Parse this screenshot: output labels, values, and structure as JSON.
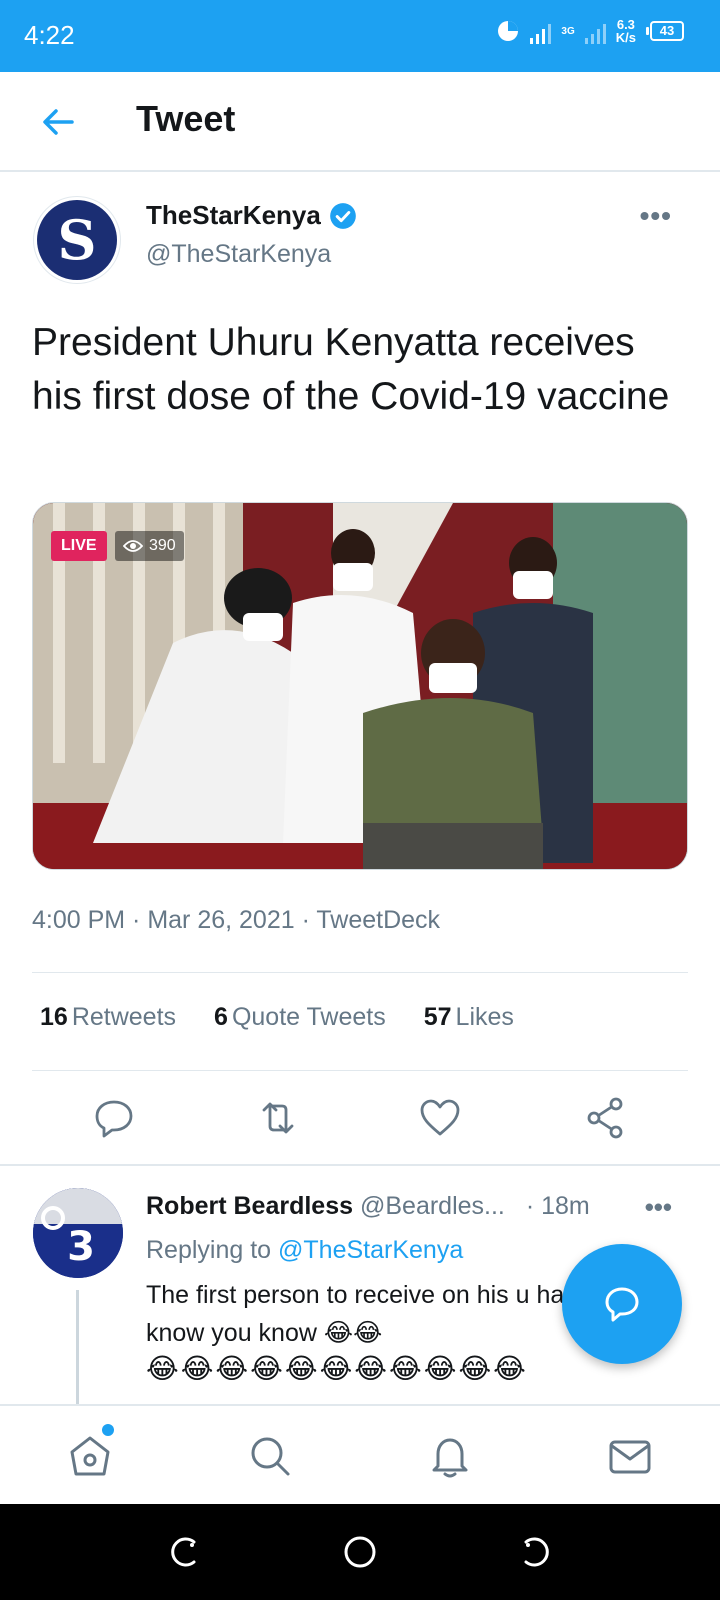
{
  "status_bar": {
    "time": "4:22",
    "speed_value": "6.3",
    "speed_unit": "K/s",
    "battery": "43",
    "network": "3G"
  },
  "header": {
    "title": "Tweet",
    "back_icon": "arrow-left-icon"
  },
  "tweet": {
    "author_name": "TheStarKenya",
    "author_handle": "@TheStarKenya",
    "avatar_letter": "S",
    "text": "President Uhuru Kenyatta receives  his first dose of the Covid-19 vaccine",
    "media": {
      "live_label": "LIVE",
      "view_count": "390"
    },
    "timestamp": "4:00 PM · Mar 26, 2021 · TweetDeck",
    "stats": {
      "retweets_count": "16",
      "retweets_label": "Retweets",
      "quotes_count": "6",
      "quotes_label": "Quote Tweets",
      "likes_count": "57",
      "likes_label": "Likes"
    },
    "more_label": "•••"
  },
  "reply": {
    "name": "Robert Beardless",
    "handle": "@Beardles...",
    "time": "· 18m",
    "replying_prefix": "Replying to",
    "replying_to": "@TheStarKenya",
    "text": "The first person to receive on his u hand, if you know you know 😂😂",
    "emoji_tail": "😂",
    "emoji_line": "😂😂😂😂😂😂😂😂😂😂😂",
    "more_label": "•••"
  },
  "colors": {
    "accent": "#1da1f2",
    "text_secondary": "#657786",
    "divider": "#e1e8ed"
  },
  "bottom_nav": [
    "home-icon",
    "search-icon",
    "notifications-icon",
    "messages-icon"
  ],
  "system_nav": [
    "recents-icon",
    "home-circle-icon",
    "back-icon"
  ]
}
